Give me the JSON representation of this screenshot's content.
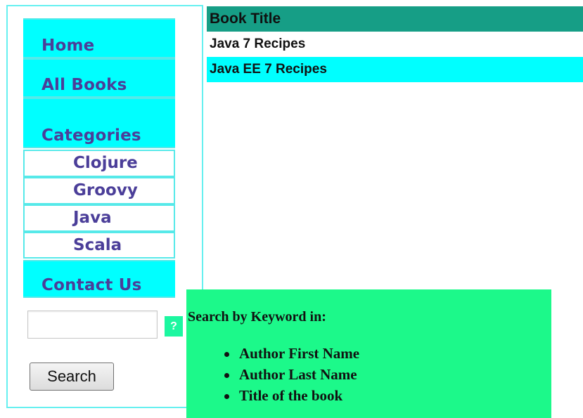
{
  "sidebar": {
    "menu": {
      "home": "Home",
      "all_books": "All Books",
      "categories": "Categories",
      "contact": "Contact Us"
    },
    "categories": [
      "Clojure",
      "Groovy",
      "Java",
      "Scala"
    ]
  },
  "search": {
    "placeholder": "",
    "button_label": "Search",
    "help_icon": "?"
  },
  "books": {
    "header": "Book Title",
    "rows": [
      "Java 7 Recipes",
      "Java EE 7 Recipes"
    ]
  },
  "search_help": {
    "title": "Search by Keyword in:",
    "items": [
      "Author First Name",
      "Author Last Name",
      "Title of the book"
    ]
  },
  "colors": {
    "menu_cyan": "#00FFFF",
    "menu_text": "#4B3E99",
    "header_teal": "#169E86",
    "help_green": "#1CF98A"
  }
}
